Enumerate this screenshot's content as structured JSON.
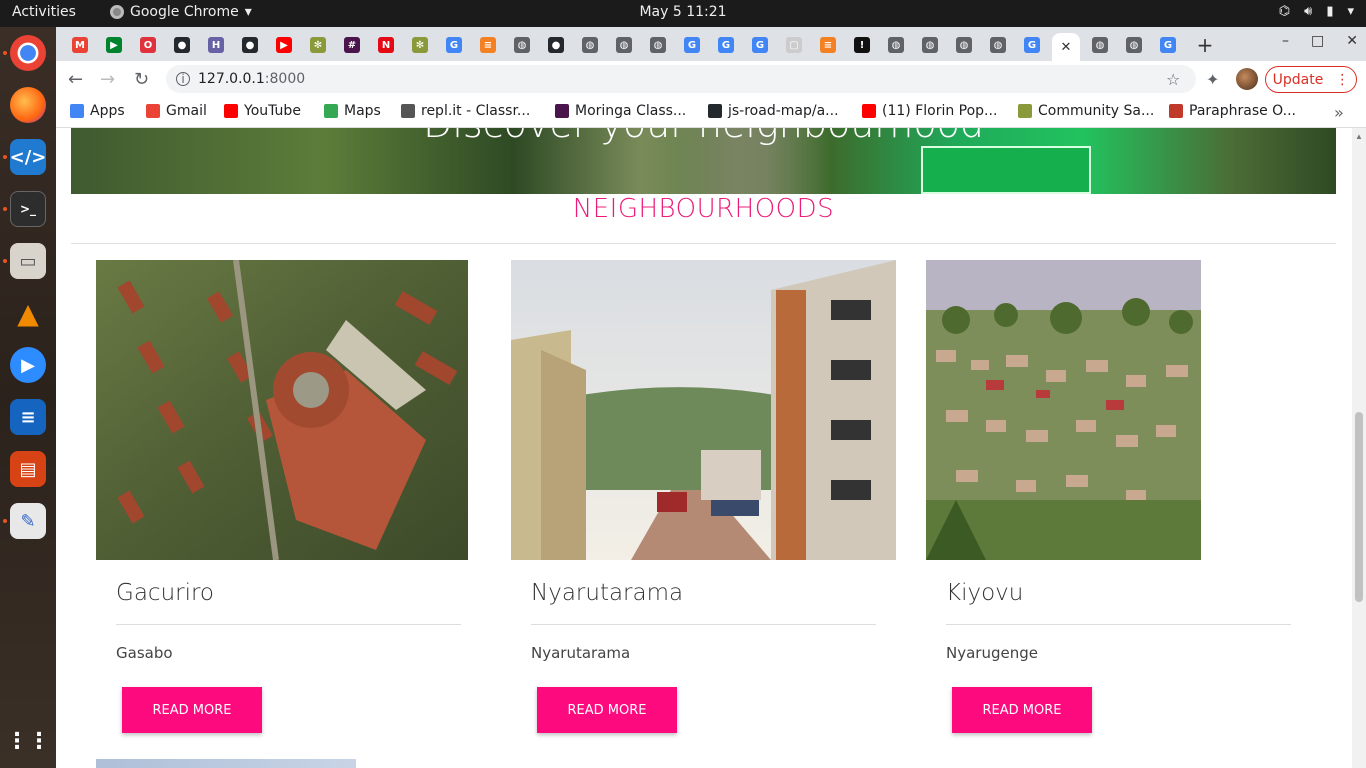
{
  "topbar": {
    "activities": "Activities",
    "app_name": "Google Chrome",
    "clock": "May 5  11:21",
    "tray_icons": [
      "network-icon",
      "volume-icon",
      "battery-icon",
      "power-menu-icon"
    ]
  },
  "dock": {
    "apps": [
      "chrome-icon",
      "firefox-icon",
      "vscode-icon",
      "terminal-icon",
      "files-icon",
      "vlc-icon",
      "zoom-icon",
      "writer-icon",
      "impress-icon",
      "text-editor-icon",
      "app-grid-icon"
    ]
  },
  "tabs": {
    "favicons": [
      "gmail-icon",
      "meet-icon",
      "opera-icon",
      "github-icon",
      "heroku-icon",
      "github-icon",
      "youtube-icon",
      "palm-icon",
      "slack-icon",
      "netflix-icon",
      "palm-icon",
      "google-icon",
      "stackoverflow-icon",
      "globe-icon",
      "github-icon",
      "globe-icon",
      "globe-icon",
      "globe-icon",
      "google-icon",
      "google-icon",
      "google-icon",
      "blank-icon",
      "stackoverflow-icon",
      "dark-app-icon",
      "globe-icon",
      "globe-icon",
      "globe-icon",
      "globe-icon",
      "google-icon",
      "close-icon",
      "globe-icon",
      "globe-icon",
      "google-icon"
    ],
    "new_tab": "+"
  },
  "window_controls": {
    "minimize": "–",
    "maximize": "□",
    "close": "✕"
  },
  "toolbar": {
    "url_host": "127.0.0.1",
    "url_port": ":8000",
    "update_label": "Update"
  },
  "bookmarks": [
    {
      "label": "Apps",
      "icon": "apps-grid-icon",
      "color": "#4285f4"
    },
    {
      "label": "Gmail",
      "icon": "gmail-icon",
      "color": "#ea4335"
    },
    {
      "label": "YouTube",
      "icon": "youtube-icon",
      "color": "#ff0000"
    },
    {
      "label": "Maps",
      "icon": "maps-icon",
      "color": "#34a853"
    },
    {
      "label": "repl.it - Classr...",
      "icon": "replit-icon",
      "color": "#555555"
    },
    {
      "label": "Moringa Class...",
      "icon": "slack-icon",
      "color": "#4a154b"
    },
    {
      "label": "js-road-map/a...",
      "icon": "github-icon",
      "color": "#24292e"
    },
    {
      "label": "(11) Florin Pop...",
      "icon": "youtube-icon",
      "color": "#ff0000"
    },
    {
      "label": "Community Sa...",
      "icon": "palm-icon",
      "color": "#8a9a3a"
    },
    {
      "label": "Paraphrase O...",
      "icon": "paraphrase-icon",
      "color": "#c0392b"
    }
  ],
  "page": {
    "hero_title": "Discover your neighbourhood",
    "section_title": "NEIGHBOURHOODS",
    "cards": [
      {
        "title": "Gacuriro",
        "location": "Gasabo",
        "button": "READ MORE"
      },
      {
        "title": "Nyarutarama",
        "location": "Nyarutarama",
        "button": "READ MORE"
      },
      {
        "title": "Kiyovu",
        "location": "Nyarugenge",
        "button": "READ MORE"
      }
    ]
  },
  "colors": {
    "accent_pink": "#fc0a7e",
    "section_title_pink": "#ec1c79",
    "update_red": "#d93025"
  }
}
